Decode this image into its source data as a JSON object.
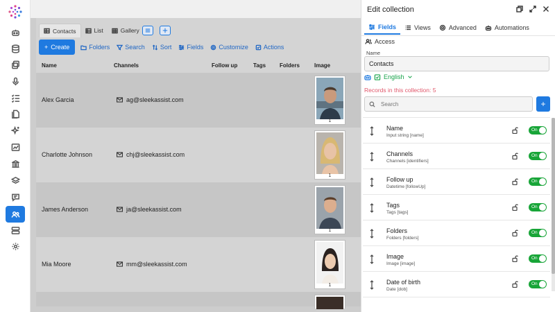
{
  "rail": {
    "items": [
      {
        "icon": "bot-icon"
      },
      {
        "icon": "database-icon"
      },
      {
        "icon": "copy-icon"
      },
      {
        "icon": "microphone-icon"
      },
      {
        "icon": "checklist-icon"
      },
      {
        "icon": "documents-icon"
      },
      {
        "icon": "sparkles-icon"
      },
      {
        "icon": "analytics-icon"
      },
      {
        "icon": "bank-icon"
      },
      {
        "icon": "layers-icon"
      },
      {
        "icon": "chat-icon"
      },
      {
        "icon": "contacts-icon",
        "active": true
      },
      {
        "icon": "server-icon"
      },
      {
        "icon": "settings-icon"
      }
    ]
  },
  "views": {
    "tabs": [
      "Contacts",
      "List",
      "Gallery"
    ]
  },
  "toolbar": {
    "create": "Create",
    "folders": "Folders",
    "search": "Search",
    "sort": "Sort",
    "fields": "Fields",
    "customize": "Customize",
    "actions": "Actions"
  },
  "table": {
    "columns": {
      "name": "Name",
      "channels": "Channels",
      "follow_up": "Follow up",
      "tags": "Tags",
      "folders": "Folders",
      "image": "Image"
    },
    "rows": [
      {
        "name": "Alex Garcia",
        "email": "ag@sleekassist.com",
        "image_count": "1"
      },
      {
        "name": "Charlotte Johnson",
        "email": "chj@sleekassist.com",
        "image_count": "1"
      },
      {
        "name": "James Anderson",
        "email": "ja@sleekassist.com",
        "image_count": "1"
      },
      {
        "name": "Mia Moore",
        "email": "mm@sleekassist.com",
        "image_count": "1"
      }
    ]
  },
  "panel": {
    "title": "Edit collection",
    "tabs": {
      "fields": "Fields",
      "views": "Views",
      "advanced": "Advanced",
      "automations": "Automations",
      "access": "Access"
    },
    "name_label": "Name",
    "name_value": "Contacts",
    "language": "English",
    "records": "Records in this collection: 5",
    "search_placeholder": "Search",
    "toggle_on": "On",
    "fields": [
      {
        "name": "Name",
        "sub": "Input string [name]"
      },
      {
        "name": "Channels",
        "sub": "Channels [identifiers]"
      },
      {
        "name": "Follow up",
        "sub": "Datetime [followUp]"
      },
      {
        "name": "Tags",
        "sub": "Tags [tags]"
      },
      {
        "name": "Folders",
        "sub": "Folders [folders]"
      },
      {
        "name": "Image",
        "sub": "Image [image]"
      },
      {
        "name": "Date of birth",
        "sub": "Date [dob]"
      }
    ]
  },
  "colors": {
    "accent": "#1f7ae0",
    "toggle_on": "#18a538",
    "records_text": "#e0566a",
    "language": "#17a34a"
  }
}
